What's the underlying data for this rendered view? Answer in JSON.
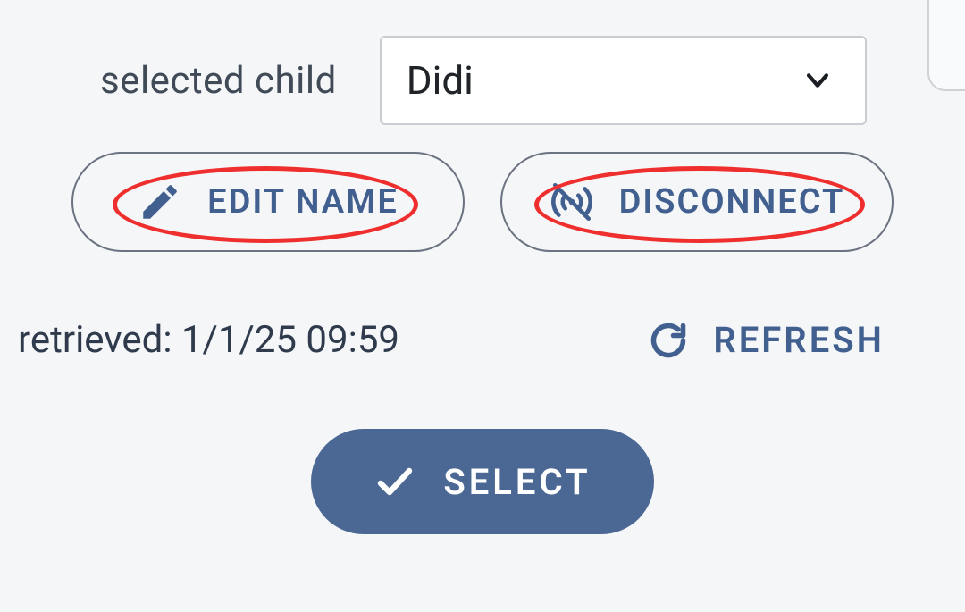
{
  "selected_child": {
    "label": "selected child",
    "value": "Didi"
  },
  "buttons": {
    "edit_name": "EDIT NAME",
    "disconnect": "DISCONNECT",
    "refresh": "REFRESH",
    "select": "SELECT"
  },
  "retrieved": {
    "prefix": "retrieved:",
    "timestamp": "1/1/25 09:59"
  },
  "annotations": {
    "edit_name_circled": true,
    "disconnect_circled": true,
    "color": "#ef2e2e"
  },
  "colors": {
    "accent": "#42608f",
    "primary_button_bg": "#4b6894",
    "text": "#2f3b4c",
    "border": "#6b7280"
  }
}
